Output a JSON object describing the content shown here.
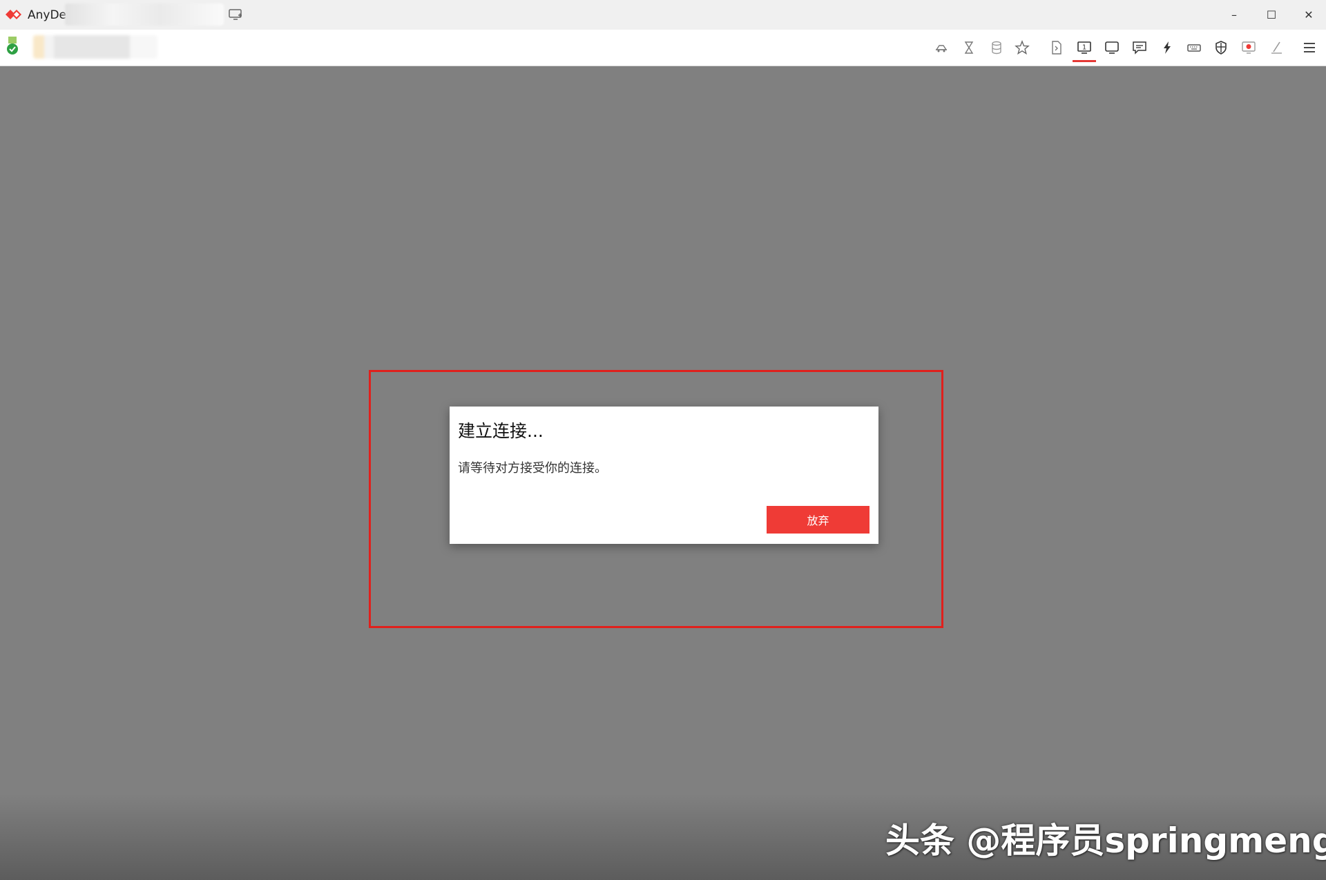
{
  "titlebar": {
    "app_name": "AnyDe",
    "minimize_glyph": "–",
    "maximize_glyph": "☐",
    "close_glyph": "✕"
  },
  "toolbar": {
    "icons": [
      "action-icon",
      "hourglass-icon",
      "database-icon",
      "star-icon",
      "file-transfer-icon",
      "monitor-one-icon",
      "display-icon",
      "chat-icon",
      "lightning-icon",
      "keyboard-icon",
      "shield-icon",
      "record-icon",
      "pen-icon",
      "menu-icon"
    ],
    "active_icon": "monitor-one-icon",
    "monitor_number": "1"
  },
  "dialog": {
    "title": "建立连接...",
    "message": "请等待对方接受你的连接。",
    "button_label": "放弃"
  },
  "watermark": {
    "text": "头条 @程序员springmeng"
  },
  "colors": {
    "brand_red": "#ef3b36",
    "highlight_red": "#e0201c",
    "canvas_gray": "#808080",
    "status_green": "#2ea043"
  }
}
